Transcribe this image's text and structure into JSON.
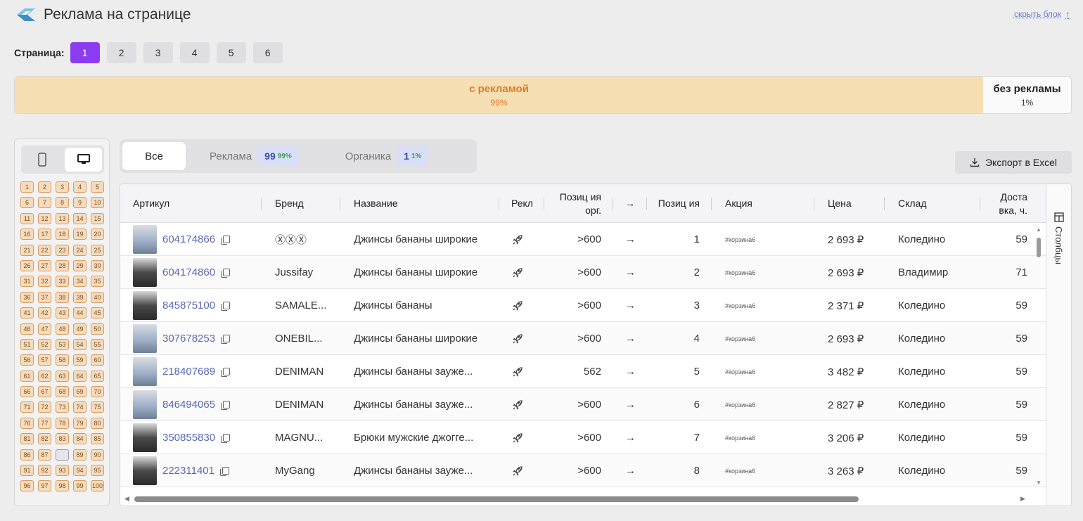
{
  "header": {
    "title": "Реклама на странице",
    "hide_label": "скрыть блок",
    "hide_arrow": "↑"
  },
  "pager": {
    "label": "Страница:",
    "pages": [
      "1",
      "2",
      "3",
      "4",
      "5",
      "6"
    ],
    "active_page": "1"
  },
  "ad_split": {
    "ads_label": "с рекламой",
    "ads_pct": "99%",
    "noads_label": "без рекламы",
    "noads_pct": "1%"
  },
  "positions": {
    "cells": [
      "1",
      "2",
      "3",
      "4",
      "5",
      "6",
      "7",
      "8",
      "9",
      "10",
      "11",
      "12",
      "13",
      "14",
      "15",
      "16",
      "17",
      "18",
      "19",
      "20",
      "21",
      "22",
      "23",
      "24",
      "25",
      "26",
      "27",
      "28",
      "29",
      "30",
      "31",
      "32",
      "33",
      "34",
      "35",
      "36",
      "37",
      "38",
      "39",
      "40",
      "41",
      "42",
      "43",
      "44",
      "45",
      "46",
      "47",
      "48",
      "49",
      "50",
      "51",
      "52",
      "53",
      "54",
      "55",
      "56",
      "57",
      "58",
      "59",
      "60",
      "61",
      "62",
      "63",
      "64",
      "65",
      "66",
      "67",
      "68",
      "69",
      "70",
      "71",
      "72",
      "73",
      "74",
      "75",
      "76",
      "77",
      "78",
      "79",
      "80",
      "81",
      "82",
      "83",
      "84",
      "85",
      "86",
      "87",
      "",
      "89",
      "90",
      "91",
      "92",
      "93",
      "94",
      "95",
      "96",
      "97",
      "98",
      "99",
      "100"
    ]
  },
  "tabs": {
    "all": "Все",
    "ads": "Реклама",
    "ads_count": "99",
    "ads_pct": "99%",
    "organic": "Органика",
    "organic_count": "1",
    "organic_pct": "1%"
  },
  "export_label": "Экспорт в Excel",
  "columns_label": "Столбцы",
  "table": {
    "headers": {
      "article": "Артикул",
      "brand": "Бренд",
      "name": "Название",
      "ad": "Рекл",
      "pos_org": "Позиц ия орг.",
      "arrow": "→",
      "pos": "Позиц ия",
      "promo": "Акция",
      "price": "Цена",
      "warehouse": "Склад",
      "delivery": "Доста вка, ч."
    },
    "rows": [
      {
        "article": "604174866",
        "brand": "ⓍⓍⓍ",
        "name": "Джинсы бананы широкие",
        "pos_org": ">600",
        "arrow": "→",
        "pos": "1",
        "promo": "#корзина6",
        "price": "2 693 ₽",
        "warehouse": "Коледино",
        "delivery": "59"
      },
      {
        "article": "604174860",
        "brand": "Jussifay",
        "name": "Джинсы бананы широкие",
        "pos_org": ">600",
        "arrow": "→",
        "pos": "2",
        "promo": "#корзина6",
        "price": "2 693 ₽",
        "warehouse": "Владимир",
        "delivery": "71"
      },
      {
        "article": "845875100",
        "brand": "SAMALE...",
        "name": "Джинсы бананы",
        "pos_org": ">600",
        "arrow": "→",
        "pos": "3",
        "promo": "#корзина6",
        "price": "2 371 ₽",
        "warehouse": "Коледино",
        "delivery": "59"
      },
      {
        "article": "307678253",
        "brand": "ONEBIL...",
        "name": "Джинсы бананы широкие",
        "pos_org": ">600",
        "arrow": "→",
        "pos": "4",
        "promo": "#корзина6",
        "price": "2 693 ₽",
        "warehouse": "Коледино",
        "delivery": "59"
      },
      {
        "article": "218407689",
        "brand": "DENIMAN",
        "name": "Джинсы бананы зауже...",
        "pos_org": "562",
        "arrow": "→",
        "pos": "5",
        "promo": "#корзина6",
        "price": "3 482 ₽",
        "warehouse": "Коледино",
        "delivery": "59"
      },
      {
        "article": "846494065",
        "brand": "DENIMAN",
        "name": "Джинсы бананы зауже...",
        "pos_org": ">600",
        "arrow": "→",
        "pos": "6",
        "promo": "#корзина6",
        "price": "2 827 ₽",
        "warehouse": "Коледино",
        "delivery": "59"
      },
      {
        "article": "350855830",
        "brand": "MAGNU...",
        "name": "Брюки мужские джогге...",
        "pos_org": ">600",
        "arrow": "→",
        "pos": "7",
        "promo": "#корзина6",
        "price": "3 206 ₽",
        "warehouse": "Коледино",
        "delivery": "59"
      },
      {
        "article": "222311401",
        "brand": "MyGang",
        "name": "Джинсы бананы зауже...",
        "pos_org": ">600",
        "arrow": "→",
        "pos": "8",
        "promo": "#корзина6",
        "price": "3 263 ₽",
        "warehouse": "Коледино",
        "delivery": "59"
      }
    ]
  },
  "colors": {
    "accent": "#8b3cf0",
    "ads_bg": "#f6e0b3",
    "ads_text": "#e07a2a",
    "link": "#5a68b8"
  }
}
